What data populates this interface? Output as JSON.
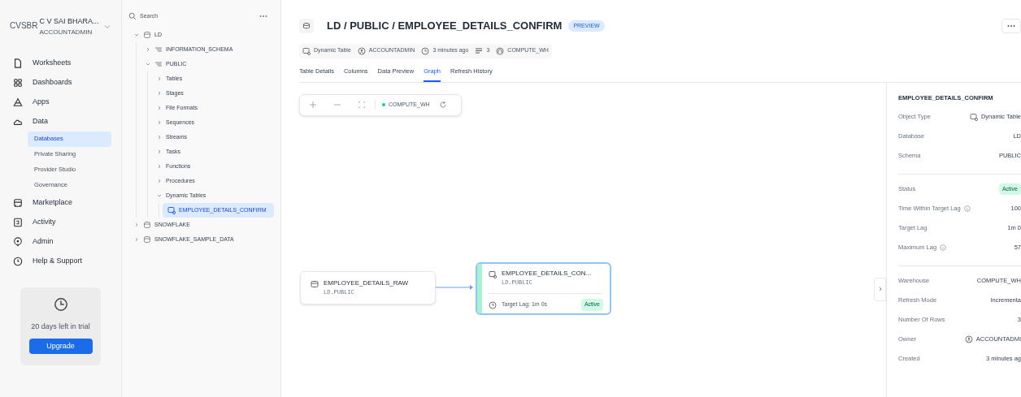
{
  "user": {
    "avatar": "CVSBR",
    "name": "C V SAI BHARA...",
    "role": "ACCOUNTADMIN"
  },
  "nav": [
    {
      "label": "Worksheets",
      "selected": false
    },
    {
      "label": "Dashboards",
      "selected": false
    },
    {
      "label": "Apps",
      "selected": false
    },
    {
      "label": "Data",
      "selected": false,
      "children": [
        {
          "label": "Databases",
          "selected": true
        },
        {
          "label": "Private Sharing",
          "selected": false
        },
        {
          "label": "Provider Studio",
          "selected": false
        },
        {
          "label": "Governance",
          "selected": false
        }
      ]
    },
    {
      "label": "Marketplace",
      "selected": false
    },
    {
      "label": "Activity",
      "selected": false
    },
    {
      "label": "Admin",
      "selected": false
    },
    {
      "label": "Help & Support",
      "selected": false
    }
  ],
  "trial": {
    "text": "20 days left in trial",
    "button": "Upgrade"
  },
  "explorer": {
    "placeholder": "Search",
    "tree": [
      {
        "label": "LD",
        "kind": "database",
        "expanded": true,
        "selected": false,
        "children": [
          {
            "label": "INFORMATION_SCHEMA",
            "kind": "schema",
            "expanded": false,
            "selected": false
          },
          {
            "label": "PUBLIC",
            "kind": "schema",
            "expanded": true,
            "selected": false,
            "children": [
              {
                "label": "Tables",
                "expanded": false,
                "selected": false
              },
              {
                "label": "Stages",
                "expanded": false,
                "selected": false
              },
              {
                "label": "File Formats",
                "expanded": false,
                "selected": false
              },
              {
                "label": "Sequences",
                "expanded": false,
                "selected": false
              },
              {
                "label": "Streams",
                "expanded": false,
                "selected": false
              },
              {
                "label": "Tasks",
                "expanded": false,
                "selected": false
              },
              {
                "label": "Functions",
                "expanded": false,
                "selected": false
              },
              {
                "label": "Procedures",
                "expanded": false,
                "selected": false
              },
              {
                "label": "Dynamic Tables",
                "expanded": true,
                "selected": false,
                "children": [
                  {
                    "label": "EMPLOYEE_DETAILS_CONFIRM",
                    "kind": "dynamic-table",
                    "selected": true
                  }
                ]
              }
            ]
          }
        ]
      },
      {
        "label": "SNOWFLAKE",
        "kind": "database",
        "expanded": false,
        "selected": false
      },
      {
        "label": "SNOWFLAKE_SAMPLE_DATA",
        "kind": "database",
        "expanded": false,
        "selected": false
      }
    ]
  },
  "header": {
    "title": "LD / PUBLIC / EMPLOYEE_DETAILS_CONFIRM",
    "badge": "PREVIEW",
    "meta": [
      {
        "kind": "table",
        "text": "Dynamic Table"
      },
      {
        "kind": "user",
        "text": "ACCOUNTADMIN"
      },
      {
        "kind": "clock",
        "text": "3 minutes ago"
      },
      {
        "kind": "rows",
        "text": "3"
      },
      {
        "kind": "warehouse",
        "text": "COMPUTE_WH"
      }
    ]
  },
  "tabs": [
    {
      "label": "Table Details",
      "selected": false
    },
    {
      "label": "Columns",
      "selected": false
    },
    {
      "label": "Data Preview",
      "selected": false
    },
    {
      "label": "Graph",
      "selected": true
    },
    {
      "label": "Refresh History",
      "selected": false
    }
  ],
  "graph_toolbar": {
    "warehouse": "COMPUTE_WH"
  },
  "graph": {
    "source": {
      "name": "EMPLOYEE_DETAILS_RAW",
      "path": "LD.PUBLIC"
    },
    "target": {
      "name": "EMPLOYEE_DETAILS_CON...",
      "path": "LD.PUBLIC",
      "lag": "Target Lag: 1m 0s",
      "status": "Active"
    }
  },
  "details": {
    "title": "EMPLOYEE_DETAILS_CONFIRM",
    "groups": [
      [
        {
          "label": "Object Type",
          "value": "Dynamic Table",
          "kind": "table"
        },
        {
          "label": "Database",
          "value": "LD",
          "kind": "text"
        },
        {
          "label": "Schema",
          "value": "PUBLIC",
          "kind": "text"
        }
      ],
      [
        {
          "label": "Status",
          "value": "Active",
          "kind": "badge"
        },
        {
          "label": "Time Within Target Lag",
          "value": "100",
          "kind": "text",
          "info": true
        },
        {
          "label": "Target Lag",
          "value": "1m 0",
          "kind": "text"
        },
        {
          "label": "Maximum Lag",
          "value": "57",
          "kind": "text",
          "info": true
        }
      ],
      [
        {
          "label": "Warehouse",
          "value": "COMPUTE_WH",
          "kind": "text"
        },
        {
          "label": "Refresh Mode",
          "value": "Incrementa",
          "kind": "text"
        },
        {
          "label": "Number Of Rows",
          "value": "3",
          "kind": "text"
        },
        {
          "label": "Owner",
          "value": "ACCOUNTADMI",
          "kind": "user"
        },
        {
          "label": "Created",
          "value": "3 minutes ag",
          "kind": "text"
        }
      ]
    ]
  }
}
